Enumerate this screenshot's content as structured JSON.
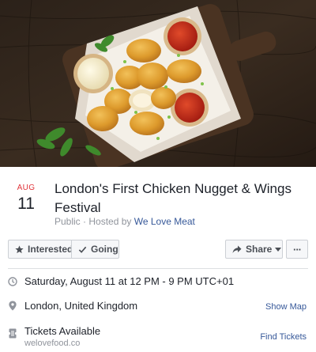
{
  "event": {
    "month": "AUG",
    "day": "11",
    "title": "London's First Chicken Nugget & Wings Festival",
    "visibility": "Public · Hosted by",
    "host": "We Love Meat"
  },
  "actions": {
    "interested": "Interested",
    "going": "Going",
    "share": "Share",
    "more": "···"
  },
  "details": {
    "datetime": "Saturday, August 11 at 12 PM - 9 PM UTC+01",
    "location": "London, United Kingdom",
    "show_map": "Show Map",
    "tickets": "Tickets Available",
    "tickets_site": "welovefood.co",
    "find_tickets": "Find Tickets"
  },
  "icons": {
    "clock": "clock-icon",
    "pin": "map-pin-icon",
    "ticket": "ticket-icon",
    "star": "star-icon",
    "check": "check-icon",
    "share": "share-arrow-icon",
    "caret": "caret-down-icon",
    "more": "more-dots-icon"
  },
  "colors": {
    "date_month": "#e1343a",
    "link": "#365899",
    "muted": "#90949c",
    "button_bg": "#f6f7f9",
    "button_border": "#ccd0d5"
  }
}
